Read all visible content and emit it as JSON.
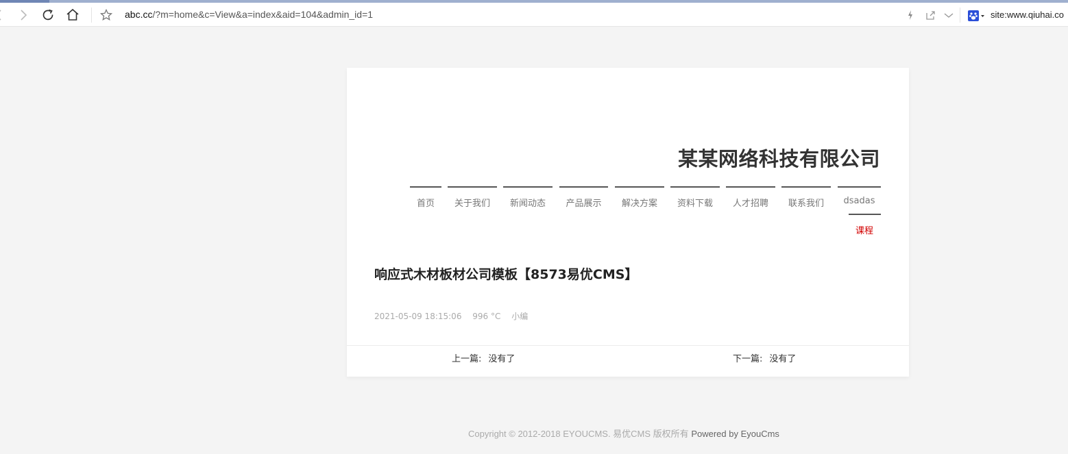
{
  "browser": {
    "url_host": "abc.cc",
    "url_path": "/?m=home&c=View&a=index&aid=104&admin_id=1",
    "search_text": "site:www.qiuhai.co",
    "icons": [
      "back-icon",
      "forward-icon",
      "reload-icon",
      "home-icon",
      "star-icon",
      "lightning-icon",
      "share-icon",
      "chevron-down-icon",
      "baidu-paw-icon"
    ]
  },
  "site": {
    "title": "某某网络科技有限公司",
    "nav": [
      {
        "label": "首页"
      },
      {
        "label": "关于我们"
      },
      {
        "label": "新闻动态"
      },
      {
        "label": "产品展示"
      },
      {
        "label": "解决方案"
      },
      {
        "label": "资料下载"
      },
      {
        "label": "人才招聘"
      },
      {
        "label": "联系我们"
      },
      {
        "label": "dsadas"
      }
    ],
    "nav_sub": "课程",
    "accent_color": "#d20000"
  },
  "article": {
    "title": "响应式木材板材公司模板【8573易优CMS】",
    "date": "2021-05-09 18:15:06",
    "views": "996 °C",
    "author": "小编"
  },
  "pager": {
    "prev_label": "上一篇:",
    "prev_value": "没有了",
    "next_label": "下一篇:",
    "next_value": "没有了"
  },
  "footer": {
    "copyright": "Copyright © 2012-2018 EYOUCMS. 易优CMS 版权所有",
    "powered": "Powered by EyouCms"
  }
}
